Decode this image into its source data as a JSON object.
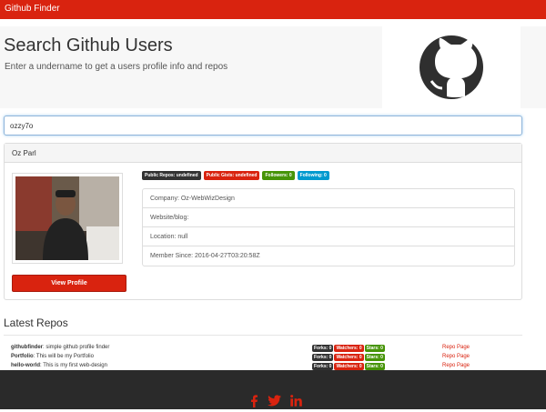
{
  "navbar": {
    "brand": "Github Finder"
  },
  "jumbotron": {
    "heading": "Search Github Users",
    "subtext": "Enter a undername to get a users profile info and repos"
  },
  "search": {
    "value": "ozzy7o"
  },
  "profile": {
    "name": "Oz Parl",
    "view_profile_label": "View Profile",
    "badges": [
      {
        "label": "Public Repos: undefined",
        "color": "#333333"
      },
      {
        "label": "Public Gists: undefined",
        "color": "#d9230f"
      },
      {
        "label": "Followers: 0",
        "color": "#469408"
      },
      {
        "label": "Following: 0",
        "color": "#029acf"
      }
    ],
    "info": [
      "Company: Oz-WebWizDesign",
      "Website/blog:",
      "Location: null",
      "Member Since: 2016-04-27T03:20:58Z"
    ]
  },
  "repos": {
    "title": "Latest Repos",
    "link_label": "Repo Page",
    "items": [
      {
        "name": "githubfinder",
        "description": ": simple github profile finder",
        "forks": "Forks: 0",
        "watchers": "Watchers: 0",
        "stars": "Stars: 0"
      },
      {
        "name": "Portfolio",
        "description": ": This will be my Portfolio",
        "forks": "Forks: 0",
        "watchers": "Watchers: 0",
        "stars": "Stars: 0"
      },
      {
        "name": "hello-world",
        "description": ": This is my first web-design",
        "forks": "Forks: 0",
        "watchers": "Watchers: 0",
        "stars": "Stars: 0"
      }
    ]
  },
  "footer": {
    "icons": [
      "facebook-icon",
      "twitter-icon",
      "linkedin-icon"
    ],
    "icon_color": "#d9230f"
  },
  "colors": {
    "accent": "#d9230f",
    "footer_bg": "#2a2a2a"
  }
}
